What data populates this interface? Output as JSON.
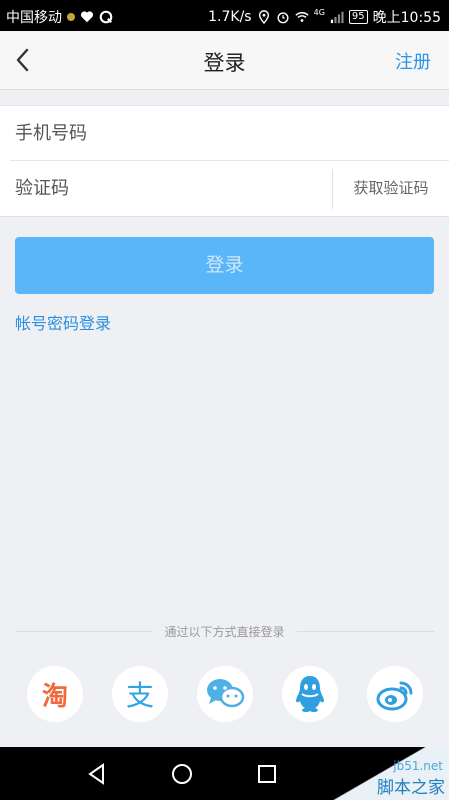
{
  "status_bar": {
    "carrier": "中国移动",
    "net_speed": "1.7K/s",
    "network_type": "4G",
    "battery": "95",
    "time": "晚上10:55"
  },
  "nav": {
    "title": "登录",
    "register": "注册"
  },
  "form": {
    "phone_placeholder": "手机号码",
    "code_placeholder": "验证码",
    "get_code": "获取验证码"
  },
  "login_button": "登录",
  "password_login": "帐号密码登录",
  "third_party": {
    "title": "通过以下方式直接登录",
    "icons": [
      "taobao-icon",
      "alipay-icon",
      "wechat-icon",
      "qq-icon",
      "weibo-icon"
    ],
    "taobao_char": "淘",
    "alipay_char": "支"
  },
  "watermark": {
    "site": "jb51.net",
    "name": "脚本之家"
  },
  "colors": {
    "accent": "#2a95e8",
    "button": "#5bb5f9",
    "taobao": "#f06a3c",
    "alipay": "#2fa5e6",
    "wechat": "#4fb0e6",
    "qq": "#2f9fe2",
    "weibo": "#2f9fe2"
  }
}
